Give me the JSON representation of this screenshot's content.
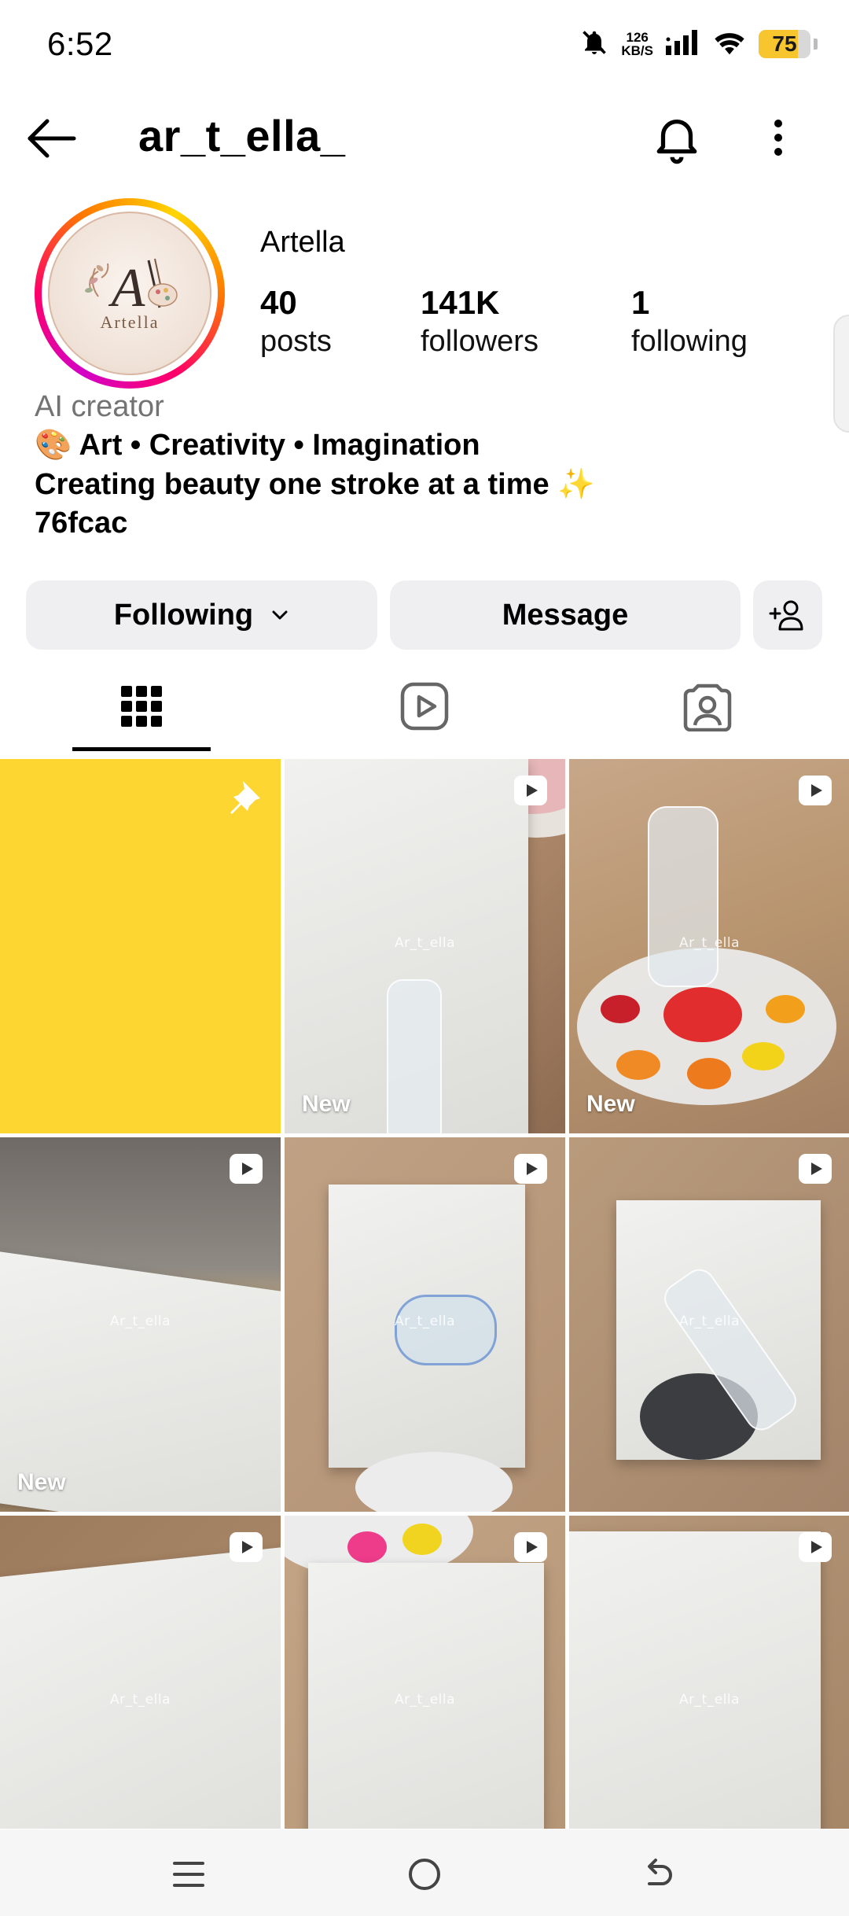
{
  "status_bar": {
    "time": "6:52",
    "net_speed_value": "126",
    "net_speed_unit": "KB/S",
    "battery_level": 75,
    "battery_text": "75",
    "battery_color": "#f7c62f"
  },
  "header": {
    "username": "ar_t_ella_",
    "back_icon": "arrow-left-icon",
    "bell_icon": "bell-icon",
    "more_icon": "more-vertical-icon"
  },
  "profile": {
    "display_name": "Artella",
    "avatar_text": "Artella",
    "stats": [
      {
        "value": "40",
        "label": "posts"
      },
      {
        "value": "141K",
        "label": "followers"
      },
      {
        "value": "1",
        "label": "following"
      }
    ],
    "category": "AI creator",
    "bio": [
      "🎨 Art • Creativity • Imagination",
      "Creating beauty one stroke at a time ✨",
      "76fcac"
    ]
  },
  "actions": {
    "following_label": "Following",
    "message_label": "Message",
    "add_user_icon": "add-user-icon"
  },
  "tabs": [
    {
      "icon": "grid-icon",
      "active": true
    },
    {
      "icon": "reels-icon",
      "active": false
    },
    {
      "icon": "tagged-icon",
      "active": false
    }
  ],
  "posts": [
    {
      "pinned": true,
      "reel": false,
      "new": false,
      "watermark": ""
    },
    {
      "pinned": false,
      "reel": true,
      "new": true,
      "new_label": "New",
      "watermark": "Ar_t_ella"
    },
    {
      "pinned": false,
      "reel": true,
      "new": true,
      "new_label": "New",
      "watermark": "Ar_t_ella"
    },
    {
      "pinned": false,
      "reel": true,
      "new": true,
      "new_label": "New",
      "watermark": "Ar_t_ella"
    },
    {
      "pinned": false,
      "reel": true,
      "new": false,
      "watermark": "Ar_t_ella"
    },
    {
      "pinned": false,
      "reel": true,
      "new": false,
      "watermark": "Ar_t_ella"
    },
    {
      "pinned": false,
      "reel": true,
      "new": false,
      "watermark": "Ar_t_ella"
    },
    {
      "pinned": false,
      "reel": true,
      "new": false,
      "watermark": "Ar_t_ella"
    },
    {
      "pinned": false,
      "reel": true,
      "new": false,
      "watermark": "Ar_t_ella"
    }
  ],
  "colors": {
    "pinned_post": "#fdd632",
    "button_bg": "#efeff2",
    "category_text": "#737373"
  },
  "navbar": {
    "menu_icon": "menu-icon",
    "home_icon": "home-circle-icon",
    "back_icon": "system-back-icon"
  }
}
